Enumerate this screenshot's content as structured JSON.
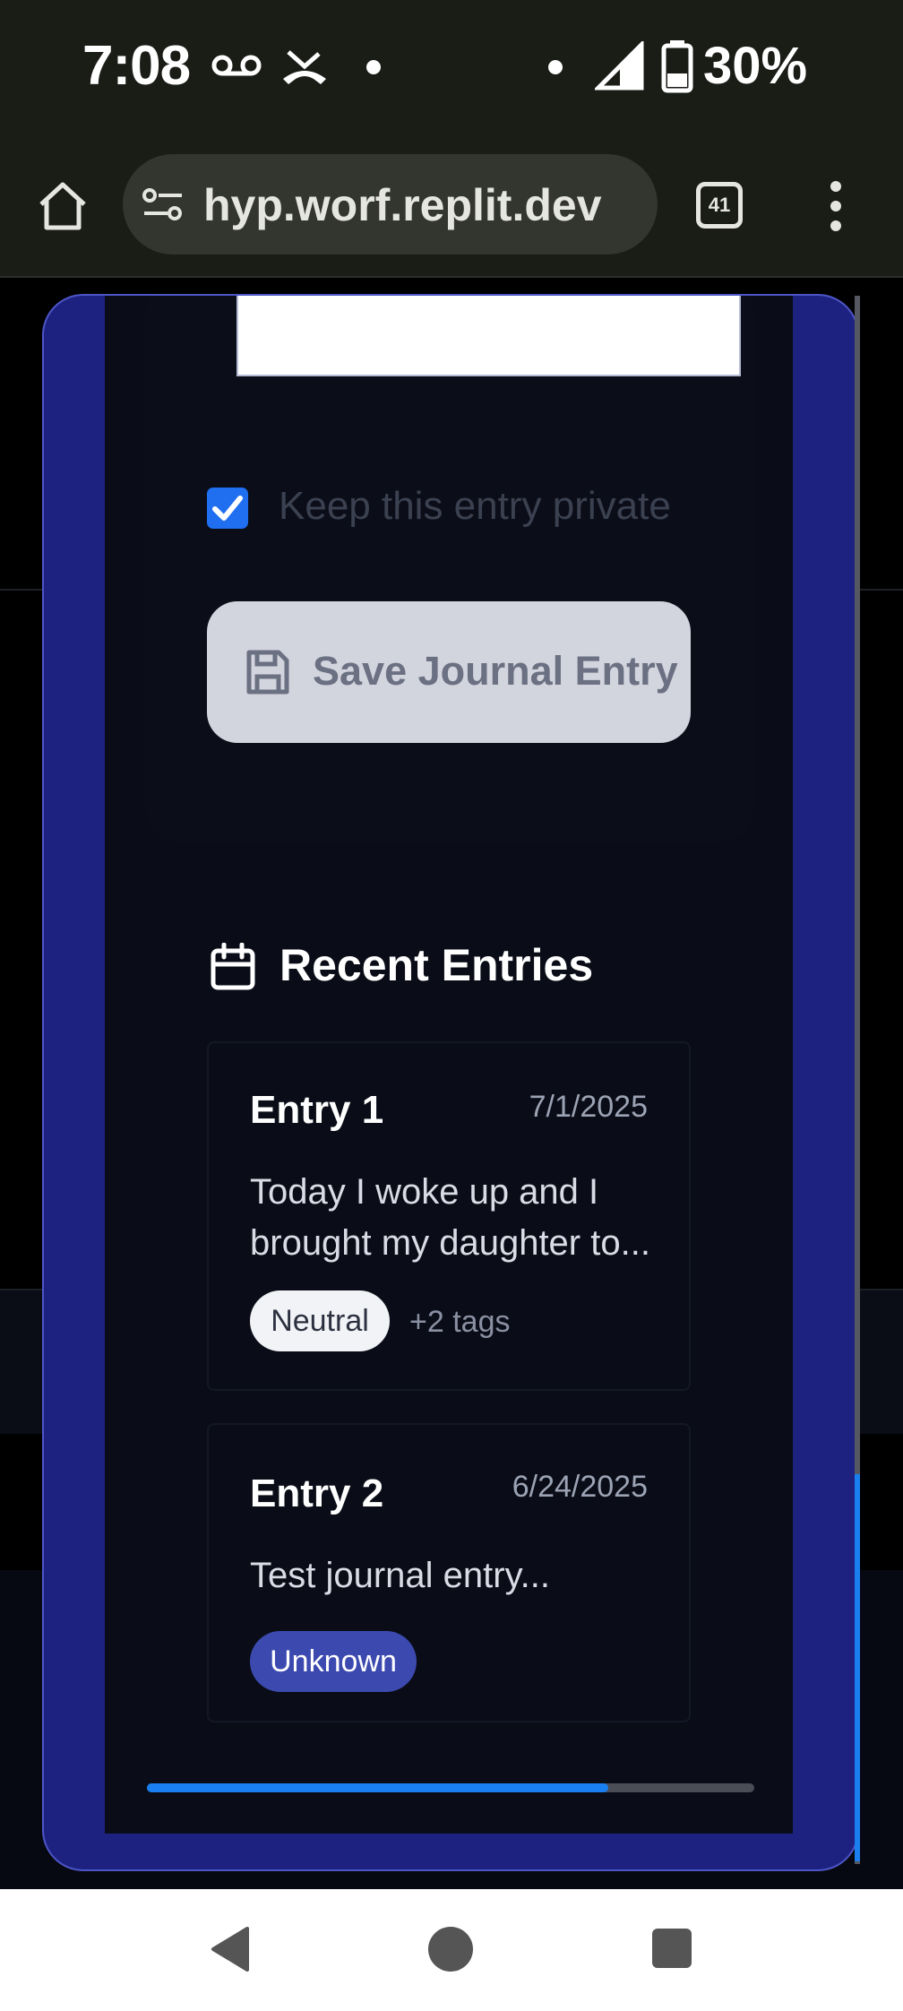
{
  "status_bar": {
    "time": "7:08",
    "battery": "30%"
  },
  "browser": {
    "url": "hyp.worf.replit.dev",
    "tab_count": "41"
  },
  "form": {
    "private_checkbox_label": "Keep this entry private",
    "private_checked": true,
    "save_button_label": "Save Journal Entry"
  },
  "recent": {
    "title": "Recent Entries",
    "entries": [
      {
        "title": "Entry 1",
        "date": "7/1/2025",
        "text": "Today I woke up and I brought my daughter to...",
        "tag": "Neutral",
        "extra_tags": "+2 tags"
      },
      {
        "title": "Entry 2",
        "date": "6/24/2025",
        "text": "Test journal entry...",
        "tag": "Unknown"
      }
    ]
  },
  "scroll": {
    "horizontal_position": 0.76,
    "vertical_position": 0.75
  },
  "colors": {
    "accent": "#1f6ff0",
    "modal_border": "#1d2280",
    "unknown_tag": "#3c4ab0"
  }
}
